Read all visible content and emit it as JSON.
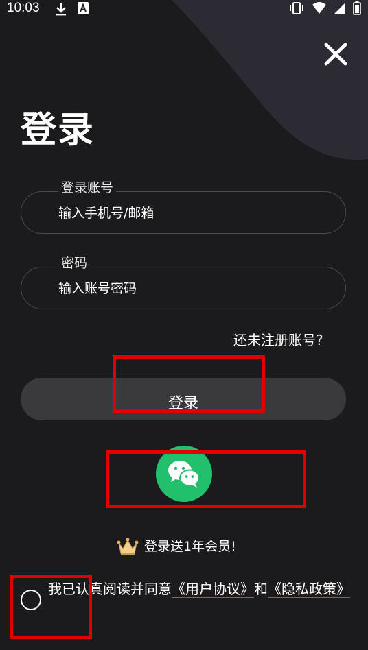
{
  "status_bar": {
    "time": "10:03",
    "icons": [
      "download-icon",
      "app-icon",
      "vibrate-icon",
      "wifi-icon",
      "signal-icon",
      "battery-icon"
    ]
  },
  "header": {
    "title": "登录",
    "close_icon": "close-icon"
  },
  "form": {
    "account": {
      "label": "登录账号",
      "placeholder": "输入手机号/邮箱"
    },
    "password": {
      "label": "密码",
      "placeholder": "输入账号密码"
    },
    "register_link": "还未注册账号?",
    "login_button": "登录"
  },
  "wechat_login": {
    "icon": "wechat-icon",
    "color": "#21c06d"
  },
  "promo": {
    "icon": "crown-icon",
    "text": "登录送1年会员!"
  },
  "agreement": {
    "prefix": "我已认真阅读并同意",
    "user_agreement": "《用户协议》",
    "and": "和",
    "privacy_policy": "《隐私政策》"
  },
  "colors": {
    "background": "#1b1b1d",
    "accent_green": "#21c06d",
    "button": "#3a3a3d",
    "highlight_red": "#e00000"
  }
}
